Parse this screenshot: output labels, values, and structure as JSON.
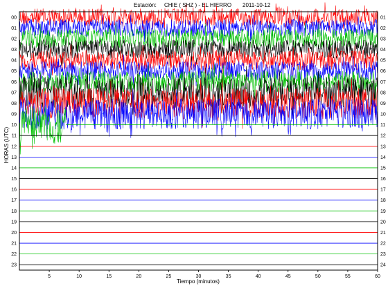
{
  "header": {
    "station_label": "Estación:",
    "station_value": "CHIE ( SHZ ) - EL HIERRO",
    "date": "2011-10-12"
  },
  "chart_data": {
    "type": "line",
    "title": "Estación:  CHIE ( SHZ ) - EL HIERRO",
    "date": "2011-10-12",
    "xlabel": "Tiempo (minutos)",
    "ylabel": "HORAS (UTC)",
    "xlim": [
      0,
      60
    ],
    "x_ticks": [
      "5",
      "10",
      "15",
      "20",
      "25",
      "30",
      "35",
      "40",
      "45",
      "50",
      "55",
      "60"
    ],
    "left_hour_labels": [
      "00",
      "01",
      "02",
      "03",
      "04",
      "05",
      "06",
      "07",
      "08",
      "09",
      "10",
      "11",
      "12",
      "13",
      "14",
      "15",
      "16",
      "17",
      "18",
      "19",
      "20",
      "21",
      "22",
      "23"
    ],
    "right_hour_labels": [
      "01",
      "02",
      "03",
      "04",
      "05",
      "06",
      "07",
      "08",
      "09",
      "10",
      "11",
      "12",
      "13",
      "14",
      "15",
      "16",
      "17",
      "18",
      "19",
      "20",
      "21",
      "22",
      "23",
      "24"
    ],
    "trace_color_cycle": [
      "#ff0000",
      "#0000ff",
      "#00c000",
      "#000000"
    ],
    "series": [
      {
        "hour": "00",
        "color": "#ff0000",
        "amplitude": 0.9,
        "state": "recorded"
      },
      {
        "hour": "01",
        "color": "#0000ff",
        "amplitude": 0.9,
        "state": "recorded"
      },
      {
        "hour": "02",
        "color": "#00c000",
        "amplitude": 1.0,
        "state": "recorded"
      },
      {
        "hour": "03",
        "color": "#000000",
        "amplitude": 1.0,
        "state": "recorded"
      },
      {
        "hour": "04",
        "color": "#ff0000",
        "amplitude": 1.0,
        "state": "recorded"
      },
      {
        "hour": "05",
        "color": "#0000ff",
        "amplitude": 1.0,
        "state": "recorded"
      },
      {
        "hour": "06",
        "color": "#00c000",
        "amplitude": 1.1,
        "state": "recorded"
      },
      {
        "hour": "07",
        "color": "#000000",
        "amplitude": 1.6,
        "state": "recorded"
      },
      {
        "hour": "08",
        "color": "#ff0000",
        "amplitude": 1.6,
        "state": "recorded"
      },
      {
        "hour": "09",
        "color": "#0000ff",
        "amplitude": 1.6,
        "state": "recorded",
        "end_minute": 60
      },
      {
        "hour": "10",
        "color": "#00c000",
        "amplitude": 2.0,
        "state": "partial",
        "end_minute": 7.8
      },
      {
        "hour": "11",
        "color": "#000000",
        "amplitude": 0,
        "state": "empty"
      },
      {
        "hour": "12",
        "color": "#ff0000",
        "amplitude": 0,
        "state": "empty"
      },
      {
        "hour": "13",
        "color": "#0000ff",
        "amplitude": 0,
        "state": "empty"
      },
      {
        "hour": "14",
        "color": "#00c000",
        "amplitude": 0,
        "state": "empty"
      },
      {
        "hour": "15",
        "color": "#000000",
        "amplitude": 0,
        "state": "empty"
      },
      {
        "hour": "16",
        "color": "#ff0000",
        "amplitude": 0,
        "state": "empty"
      },
      {
        "hour": "17",
        "color": "#0000ff",
        "amplitude": 0,
        "state": "empty"
      },
      {
        "hour": "18",
        "color": "#00c000",
        "amplitude": 0,
        "state": "empty"
      },
      {
        "hour": "19",
        "color": "#000000",
        "amplitude": 0,
        "state": "empty"
      },
      {
        "hour": "20",
        "color": "#ff0000",
        "amplitude": 0,
        "state": "empty"
      },
      {
        "hour": "21",
        "color": "#0000ff",
        "amplitude": 0,
        "state": "empty"
      },
      {
        "hour": "22",
        "color": "#00c000",
        "amplitude": 0,
        "state": "empty"
      },
      {
        "hour": "23",
        "color": "#000000",
        "amplitude": 0,
        "state": "empty"
      }
    ]
  }
}
